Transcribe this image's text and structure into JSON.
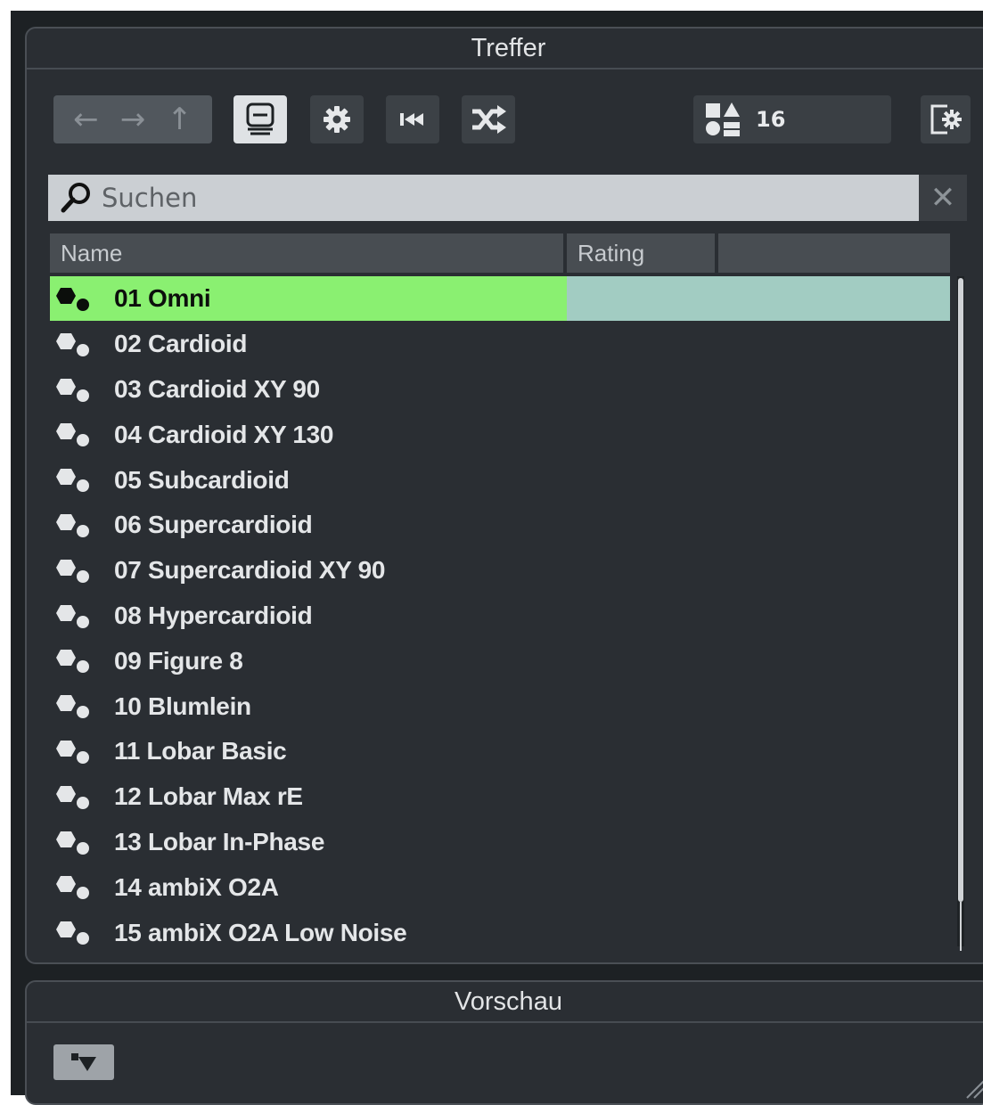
{
  "panels": {
    "results_title": "Treffer",
    "preview_title": "Vorschau"
  },
  "toolbar": {
    "nav_back": "←",
    "nav_forward": "→",
    "nav_up": "↑",
    "result_count": "16"
  },
  "search": {
    "placeholder": "Suchen",
    "value": "",
    "clear": "✕"
  },
  "columns": [
    "Name",
    "Rating",
    ""
  ],
  "items": [
    {
      "name": "01 Omni",
      "selected": true
    },
    {
      "name": "02 Cardioid"
    },
    {
      "name": "03 Cardioid XY 90"
    },
    {
      "name": "04 Cardioid XY 130"
    },
    {
      "name": "05 Subcardioid"
    },
    {
      "name": "06 Supercardioid"
    },
    {
      "name": "07 Supercardioid XY 90"
    },
    {
      "name": "08 Hypercardioid"
    },
    {
      "name": "09 Figure 8"
    },
    {
      "name": "10 Blumlein"
    },
    {
      "name": "11 Lobar Basic"
    },
    {
      "name": "12 Lobar Max rE"
    },
    {
      "name": "13 Lobar In-Phase"
    },
    {
      "name": "14 ambiX O2A"
    },
    {
      "name": "15 ambiX O2A Low Noise"
    }
  ],
  "colors": {
    "selection": "#8af071",
    "selection_rating": "#a2ccc2",
    "panel_bg": "#2a2e33"
  },
  "icons": {
    "item_icon": "preset-icon",
    "view": "document-view-icon",
    "settings": "gear-icon",
    "rewind": "rewind-icon",
    "shuffle": "shuffle-icon",
    "filter": "filter-icon",
    "configure": "configure-icon",
    "preview": "preview-toggle-icon"
  }
}
